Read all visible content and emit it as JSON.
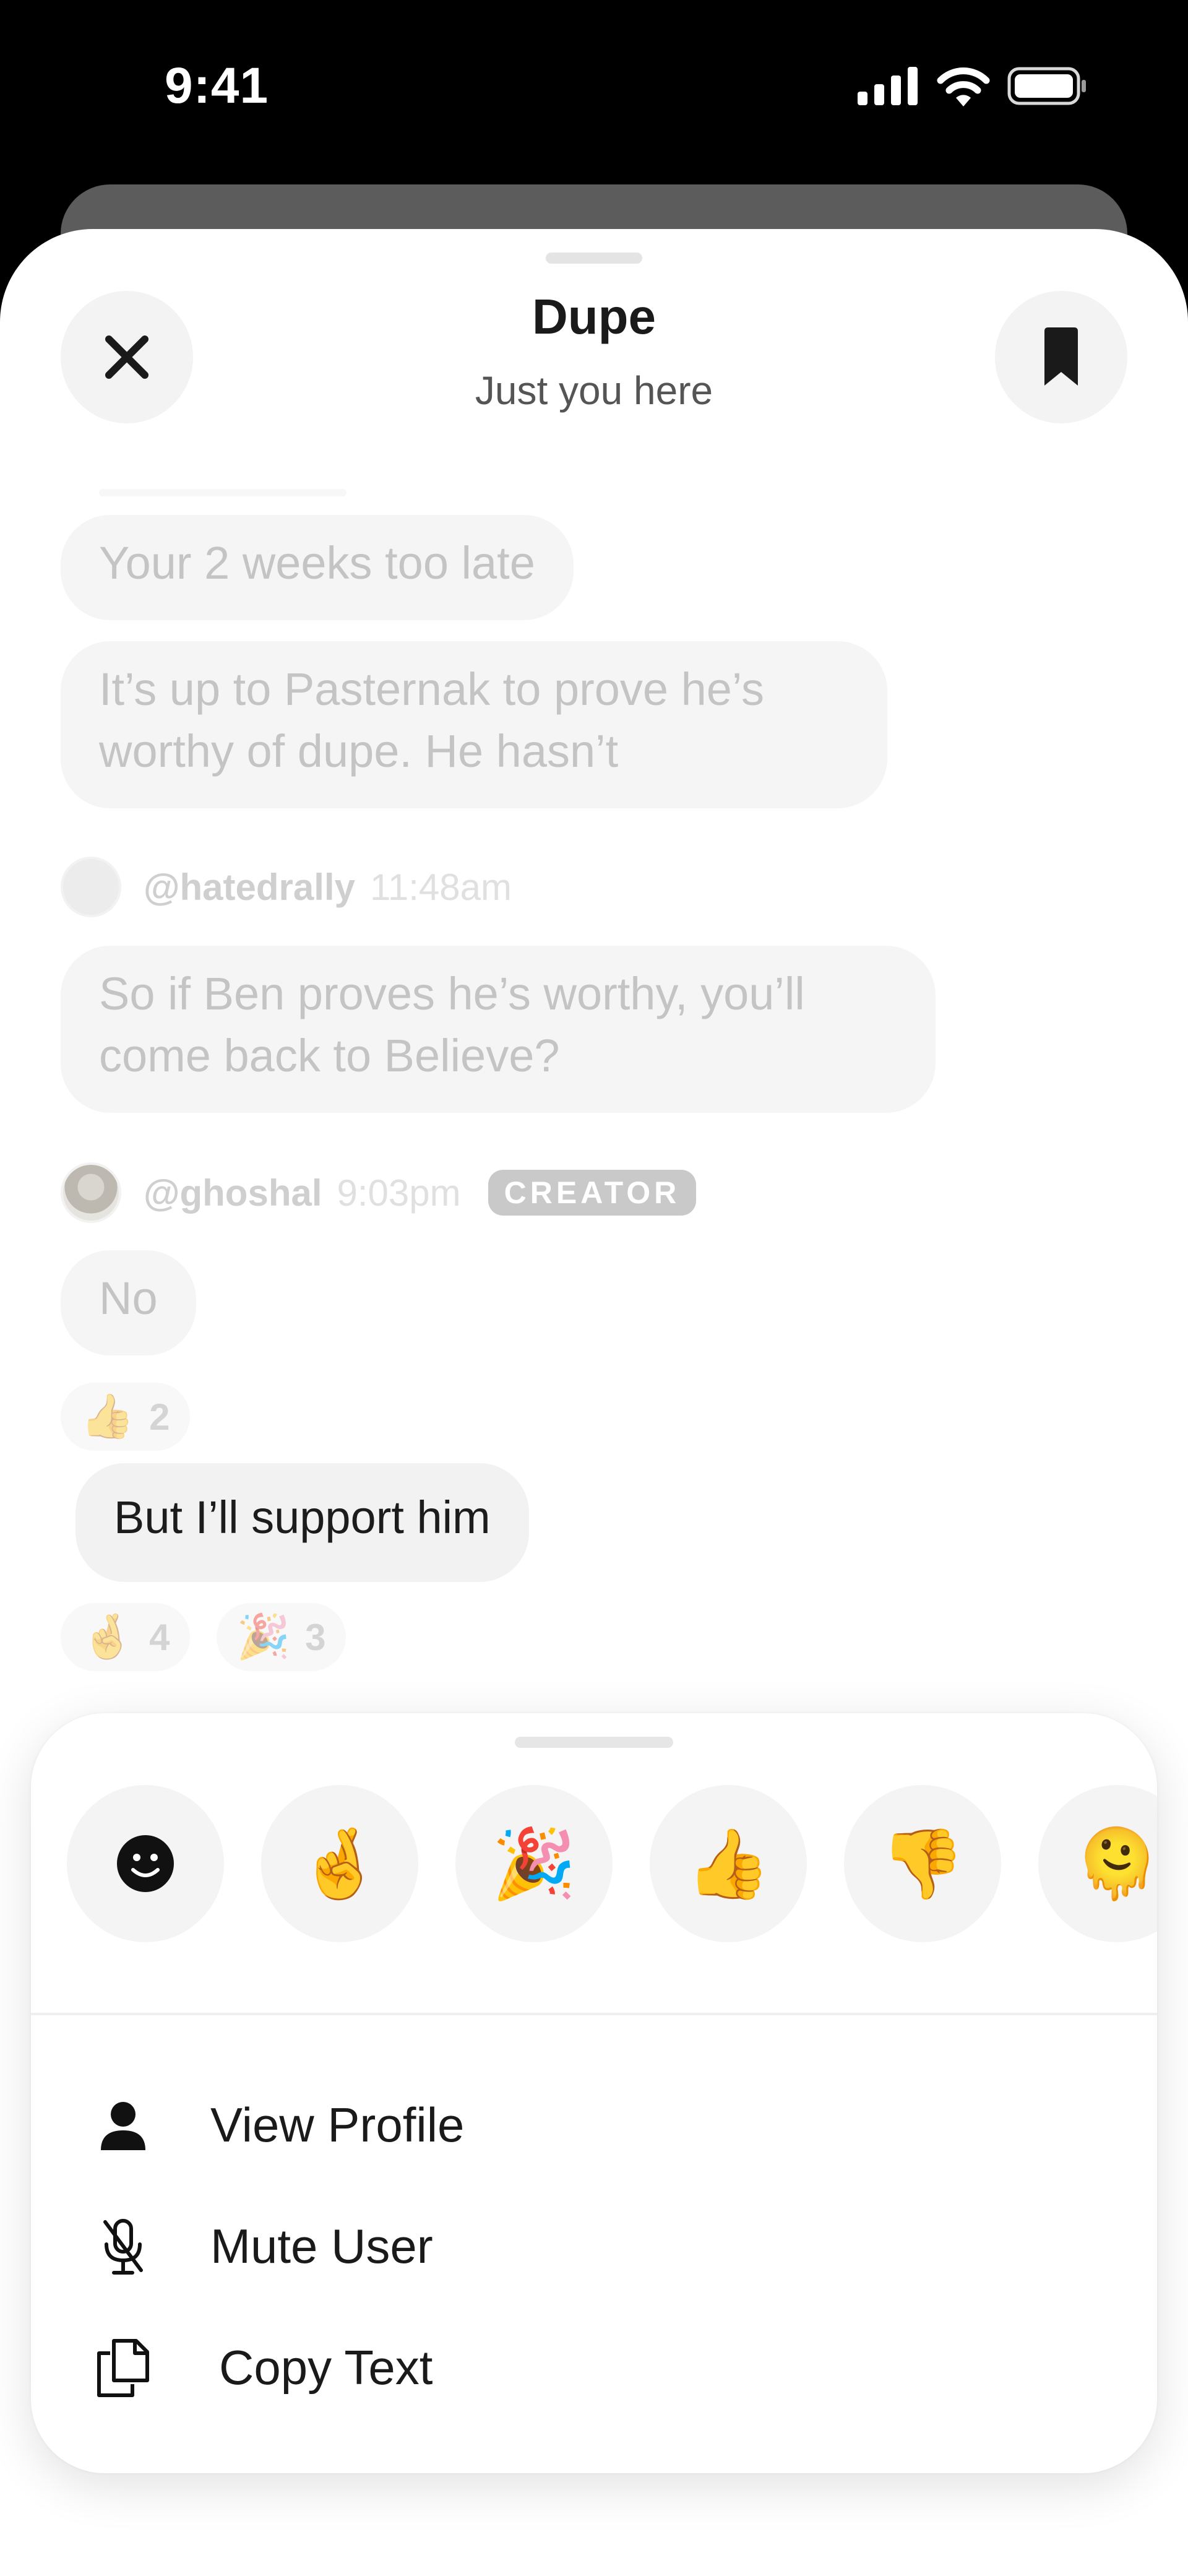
{
  "status_bar": {
    "time": "9:41",
    "icons": [
      "signal-icon",
      "wifi-icon",
      "battery-icon"
    ]
  },
  "header": {
    "title": "Dupe",
    "subtitle": "Just you here",
    "close_icon": "close-icon",
    "bookmark_icon": "bookmark-icon"
  },
  "messages": {
    "m1": "Your 2 weeks too late",
    "m2_line1": "It’s up to Pasternak to prove he’s",
    "m2_line2": "worthy of dupe. He hasn’t",
    "hatedrally": {
      "username": "@hatedrally",
      "time": "11:48am"
    },
    "m3_line1": "So if Ben proves he’s worthy, you’ll",
    "m3_line2": "come back to Believe?",
    "ghoshal": {
      "username": "@ghoshal",
      "time": "9:03pm",
      "badge": "CREATOR"
    },
    "m4": "No",
    "m4_reaction": {
      "emoji": "👍",
      "count": "2"
    },
    "m5": "But I’ll support him",
    "m5_reactions": [
      {
        "emoji": "🤞",
        "count": "4"
      },
      {
        "emoji": "🎉",
        "count": "3"
      }
    ]
  },
  "action_sheet": {
    "reactions": [
      {
        "name": "add-reaction-button",
        "icon": "smiley-icon"
      },
      {
        "name": "reaction-crossed-fingers",
        "emoji": "🤞"
      },
      {
        "name": "reaction-party-popper",
        "emoji": "🎉"
      },
      {
        "name": "reaction-thumbs-up",
        "emoji": "👍"
      },
      {
        "name": "reaction-thumbs-down",
        "emoji": "👎"
      },
      {
        "name": "reaction-melting-face",
        "emoji": "🫠"
      }
    ],
    "menu": {
      "view_profile": "View Profile",
      "mute_user": "Mute User",
      "copy_text": "Copy Text"
    }
  },
  "colors": {
    "background": "#000000",
    "sheet": "#ffffff",
    "bubble": "#f5f5f5",
    "text_primary": "#1a1a1a",
    "text_muted": "#c4c4c4",
    "badge": "#c9c9c9"
  }
}
